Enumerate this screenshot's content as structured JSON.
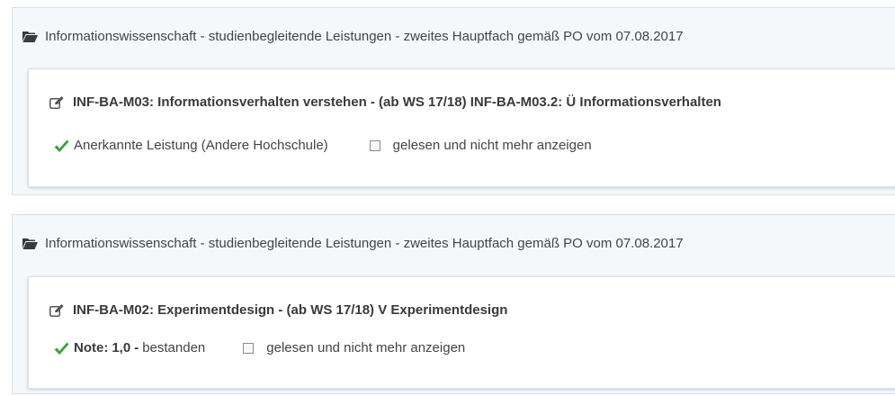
{
  "entries": [
    {
      "heading": "Informationswissenschaft - studienbegleitende Leistungen - zweites Hauptfach gemäß PO vom 07.08.2017",
      "title": "INF-BA-M03:  Informationsverhalten verstehen -  (ab WS 17/18)  INF-BA-M03.2: Ü Informationsverhalten",
      "status": "Anerkannte Leistung (Andere Hochschule)",
      "checkbox_label": "gelesen und nicht mehr anzeigen",
      "checked": false
    },
    {
      "heading": "Informationswissenschaft - studienbegleitende Leistungen - zweites Hauptfach gemäß PO vom 07.08.2017",
      "title": "INF-BA-M02:  Experimentdesign -  (ab WS 17/18)  V Experimentdesign",
      "note_label": "Note:",
      "grade": "1,0",
      "dash": "-",
      "status": "bestanden",
      "checkbox_label": "gelesen und nicht mehr anzeigen",
      "checked": false
    }
  ],
  "icons": {
    "folder": "folder-open-icon",
    "edit": "edit-icon",
    "check": "check-icon"
  },
  "colors": {
    "check_green": "#3aa335",
    "panel_bg": "#f5f8fb"
  }
}
